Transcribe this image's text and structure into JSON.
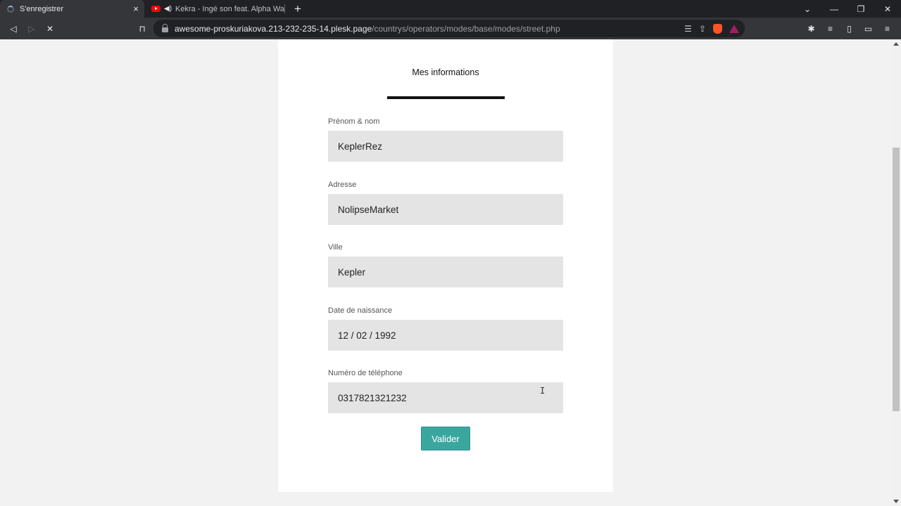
{
  "browser": {
    "tabs": [
      {
        "title": "S'enregistrer",
        "active": true,
        "close": "×"
      },
      {
        "title": "Kekra - Ingé son feat. Alpha Wann",
        "active": false
      }
    ],
    "new_tab": "+",
    "url_host": "awesome-proskuriakova.213-232-235-14.plesk.page",
    "url_path": "/countrys/operators/modes/base/modes/street.php",
    "window_controls": {
      "chevron": "⌄",
      "minimize": "—",
      "restore": "❐",
      "close": "✕"
    }
  },
  "form": {
    "section_title": "Mes informations",
    "fields": [
      {
        "label": "Prénom & nom",
        "value": "KeplerRez"
      },
      {
        "label": "Adresse",
        "value": "NolipseMarket"
      },
      {
        "label": "Ville",
        "value": "Kepler"
      },
      {
        "label": "Date de naissance",
        "value": "12 / 02 / 1992"
      },
      {
        "label": "Numéro de téléphone",
        "value": "0317821321232"
      }
    ],
    "submit_label": "Valider"
  },
  "colors": {
    "accent": "#3aa79f",
    "input_bg": "#e4e4e4",
    "page_bg": "#f2f2f2"
  }
}
